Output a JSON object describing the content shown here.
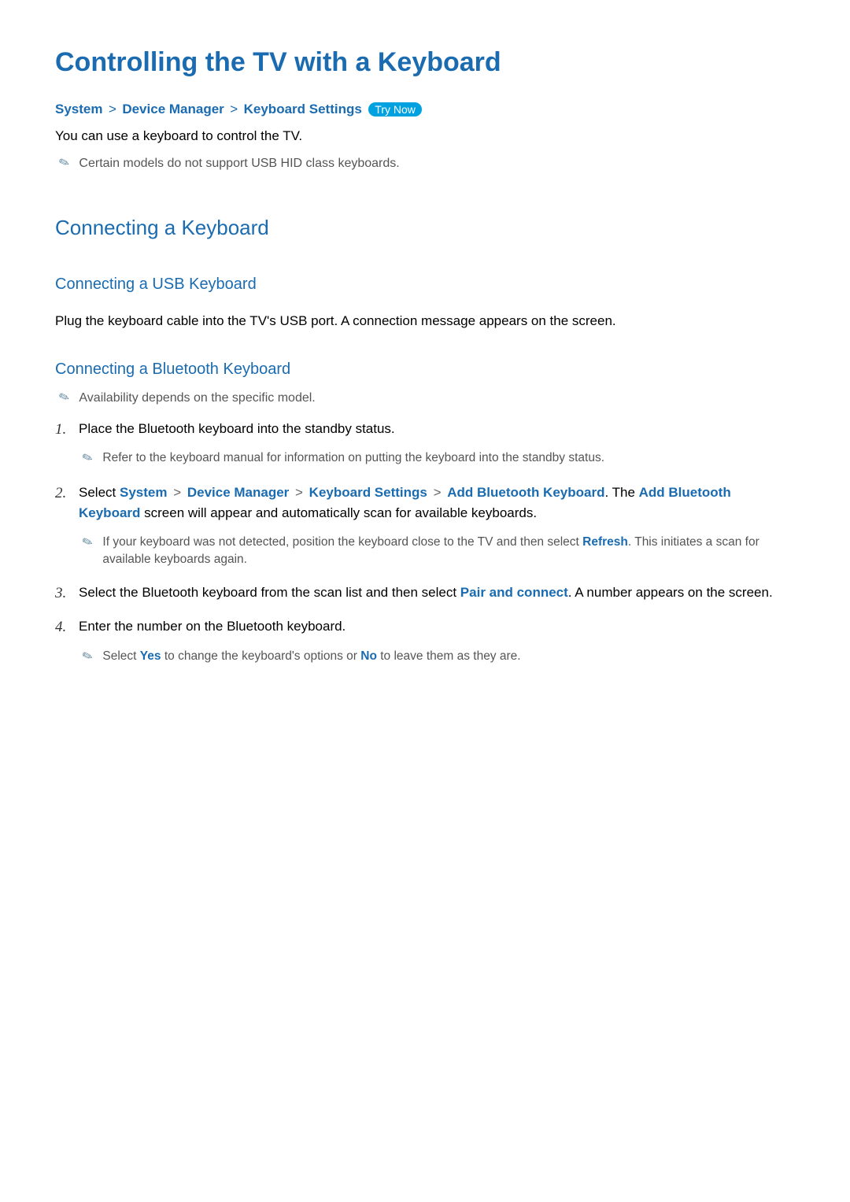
{
  "title": "Controlling the TV with a Keyboard",
  "breadcrumb": {
    "items": [
      "System",
      "Device Manager",
      "Keyboard Settings"
    ],
    "try_now": "Try Now"
  },
  "intro": "You can use a keyboard to control the TV.",
  "note1": "Certain models do not support USB HID class keyboards.",
  "section1": {
    "heading": "Connecting a Keyboard",
    "usb": {
      "heading": "Connecting a USB Keyboard",
      "text": "Plug the keyboard cable into the TV's USB port. A connection message appears on the screen."
    },
    "bt": {
      "heading": "Connecting a Bluetooth Keyboard",
      "availability_note": "Availability depends on the specific model.",
      "steps": {
        "s1": {
          "text": "Place the Bluetooth keyboard into the standby status.",
          "note": "Refer to the keyboard manual for information on putting the keyboard into the standby status."
        },
        "s2": {
          "prefix": "Select ",
          "path": [
            "System",
            "Device Manager",
            "Keyboard Settings",
            "Add Bluetooth Keyboard"
          ],
          "after_path": ". The ",
          "highlight": "Add Bluetooth Keyboard",
          "suffix": " screen will appear and automatically scan for available keyboards.",
          "note_prefix": "If your keyboard was not detected, position the keyboard close to the TV and then select ",
          "note_highlight": "Refresh",
          "note_suffix": ". This initiates a scan for available keyboards again."
        },
        "s3": {
          "prefix": "Select the Bluetooth keyboard from the scan list and then select ",
          "highlight": "Pair and connect",
          "suffix": ". A number appears on the screen."
        },
        "s4": {
          "text": "Enter the number on the Bluetooth keyboard.",
          "note_prefix": "Select ",
          "note_yes": "Yes",
          "note_mid": " to change the keyboard's options or ",
          "note_no": "No",
          "note_suffix": " to leave them as they are."
        }
      }
    }
  }
}
